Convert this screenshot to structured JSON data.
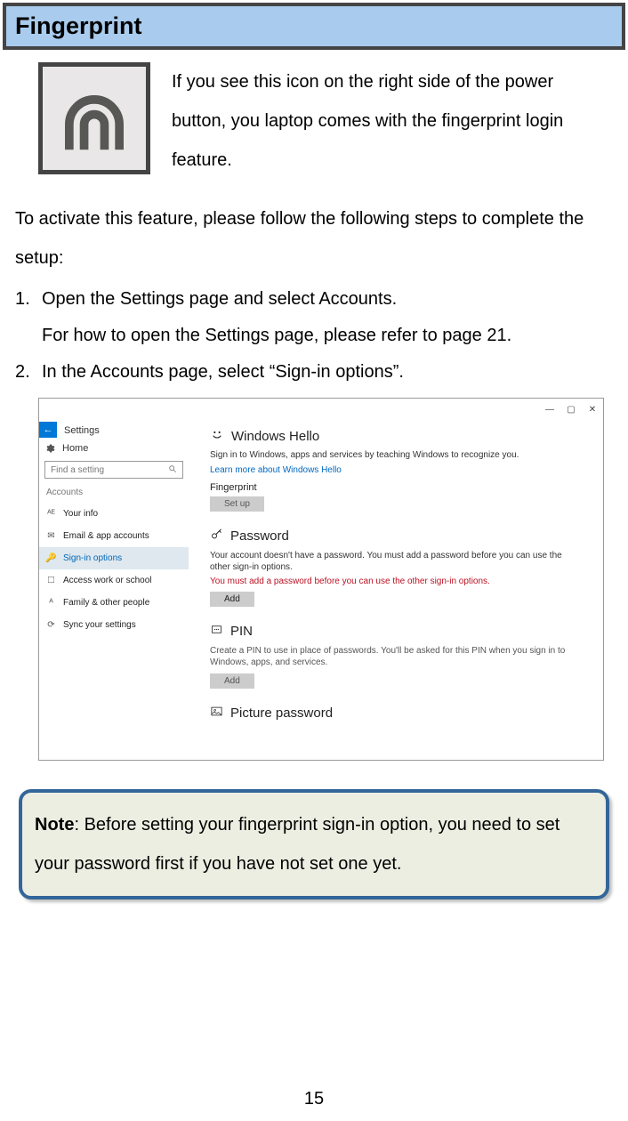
{
  "header": {
    "title": "Fingerprint"
  },
  "intro": "If you see this icon on the right side of the power button, you laptop comes with the fingerprint login feature.",
  "setup_intro": "To activate this feature, please follow the following steps to complete the setup:",
  "steps": [
    {
      "num": "1.",
      "line1": "Open the Settings page and select Accounts.",
      "line2": "For how to open the Settings page, please refer to page 21."
    },
    {
      "num": "2.",
      "line1": "In the Accounts page, select “Sign-in options”."
    }
  ],
  "screenshot": {
    "settings_label": "Settings",
    "home": "Home",
    "search_placeholder": "Find a setting",
    "group": "Accounts",
    "items": [
      {
        "icon": "user",
        "label": "Your info"
      },
      {
        "icon": "mail",
        "label": "Email & app accounts"
      },
      {
        "icon": "key",
        "label": "Sign-in options",
        "active": true
      },
      {
        "icon": "bag",
        "label": "Access work or school"
      },
      {
        "icon": "people",
        "label": "Family & other people"
      },
      {
        "icon": "sync",
        "label": "Sync your settings"
      }
    ],
    "hello": {
      "title": "Windows Hello",
      "desc": "Sign in to Windows, apps and services by teaching Windows to recognize you.",
      "link": "Learn more about Windows Hello",
      "fp_label": "Fingerprint",
      "setup_btn": "Set up"
    },
    "password": {
      "title": "Password",
      "desc": "Your account doesn't have a password. You must add a password before you can use the other sign-in options.",
      "warn": "You must add a password before you can use the other sign-in options.",
      "add_btn": "Add"
    },
    "pin": {
      "title": "PIN",
      "desc": "Create a PIN to use in place of passwords. You'll be asked for this PIN when you sign in to Windows, apps, and services.",
      "add_btn": "Add"
    },
    "picture": {
      "title": "Picture password"
    }
  },
  "note": {
    "label": "Note",
    "text": ": Before setting your fingerprint sign-in option, you need to set your password first if you have not set one yet."
  },
  "page_number": "15"
}
